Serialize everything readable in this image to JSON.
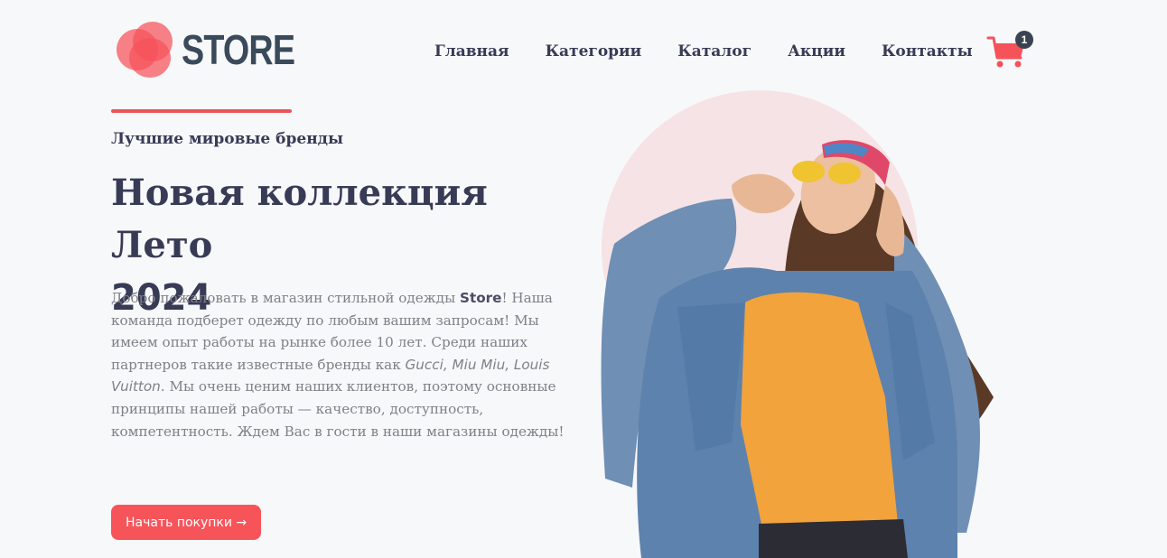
{
  "brand": {
    "name": "STORE"
  },
  "nav": {
    "items": [
      {
        "label": "Главная"
      },
      {
        "label": "Категории"
      },
      {
        "label": "Каталог"
      },
      {
        "label": "Акции"
      },
      {
        "label": "Контакты"
      }
    ]
  },
  "cart": {
    "icon": "shopping-cart-icon",
    "count": "1",
    "color": "#f6525a"
  },
  "hero": {
    "subtitle": "Лучшие мировые бренды",
    "title_line1": "Новая коллекция Лето",
    "title_line2": "2024",
    "desc": {
      "part1": "Добро пожаловать в магазин стильной одежды ",
      "store": "Store",
      "part2": "! Наша команда подберет одежду по любым вашим запросам! Мы имеем опыт работы на рынке более 10 лет. Среди наших партнеров такие известные бренды как ",
      "brands": "Gucci, Miu Miu, Louis Vuitton",
      "part3": ". Мы очень ценим наших клиентов, поэтому основные принципы нашей работы — качество, доступность, компетентность. Ждем Вас в гости в наши магазины одежды!"
    },
    "cta_label": "Начать покупки →"
  },
  "colors": {
    "accent": "#f6525a",
    "heading": "#383b55",
    "text": "#808087",
    "circle": "#f6e3e5"
  }
}
